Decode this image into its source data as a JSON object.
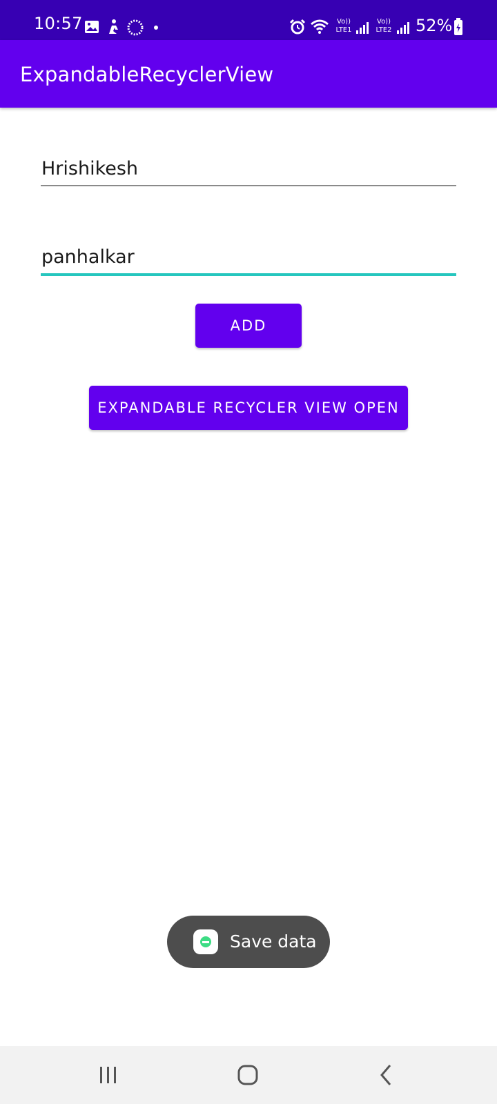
{
  "status_bar": {
    "time": "10:57",
    "battery": "52%",
    "sim1_label": "Vo)) LTE1",
    "sim2_label": "Vo)) LTE2",
    "icons": [
      "image-icon",
      "person-icon",
      "sync-icon",
      "dot-icon",
      "alarm-icon",
      "wifi-icon",
      "signal-icon",
      "signal-icon",
      "battery-charging-icon"
    ]
  },
  "app_bar": {
    "title": "ExpandableRecyclerView"
  },
  "form": {
    "first_name_value": "Hrishikesh",
    "last_name_value": "panhalkar"
  },
  "buttons": {
    "add_label": "ADD",
    "open_label": "EXPANDABLE RECYCLER VIEW OPEN"
  },
  "toast": {
    "message": "Save data"
  },
  "nav_bar": {
    "icons": [
      "recent-apps-icon",
      "home-icon",
      "back-icon"
    ]
  },
  "colors": {
    "status_bar": "#3700b3",
    "primary": "#6200ee",
    "accent_underline": "#26c6be",
    "toast_bg": "#4d4d4d"
  }
}
